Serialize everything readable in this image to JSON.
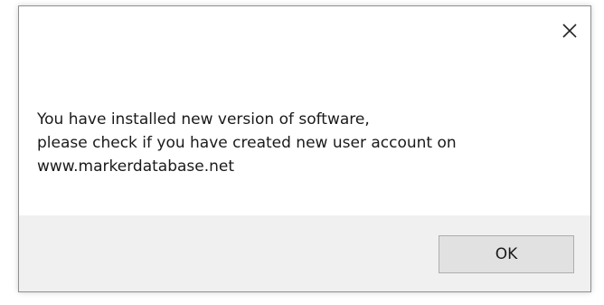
{
  "dialog": {
    "close_icon": "close-icon",
    "message_lines": [
      "You have installed new version of software,",
      "please check if you have created new user account on",
      "www.markerdatabase.net"
    ],
    "ok_label": "OK"
  }
}
